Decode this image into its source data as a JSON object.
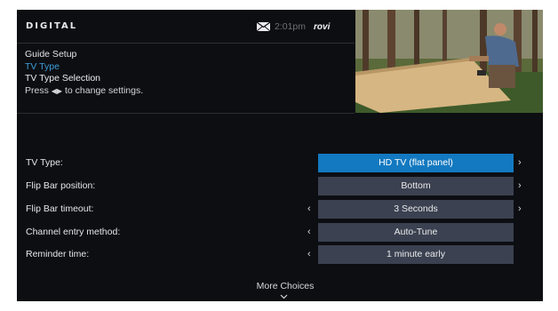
{
  "header": {
    "logo": "DIGITAL",
    "time": "2:01pm",
    "brand": "rovi",
    "mail_icon": "envelope-icon"
  },
  "breadcrumb": {
    "title": "Guide Setup",
    "subtitle": "TV Type",
    "current": "TV Type Selection",
    "instruction_prefix": "Press",
    "instruction_arrows": "◀▶",
    "instruction_suffix": "to change settings."
  },
  "settings": [
    {
      "label": "TV Type:",
      "value": "HD TV (flat panel)",
      "selected": true,
      "left_arrow": false,
      "right_arrow": true
    },
    {
      "label": "Flip Bar position:",
      "value": "Bottom",
      "selected": false,
      "left_arrow": false,
      "right_arrow": true
    },
    {
      "label": "Flip Bar timeout:",
      "value": "3 Seconds",
      "selected": false,
      "left_arrow": true,
      "right_arrow": true
    },
    {
      "label": "Channel entry method:",
      "value": "Auto-Tune",
      "selected": false,
      "left_arrow": true,
      "right_arrow": false
    },
    {
      "label": "Reminder time:",
      "value": "1 minute early",
      "selected": false,
      "left_arrow": true,
      "right_arrow": false
    }
  ],
  "footer": {
    "more_label": "More Choices",
    "more_icon": "chevron-down-icon"
  },
  "colors": {
    "background": "#0d0e12",
    "accent": "#1379c0",
    "subtitle": "#3f9dd8",
    "row": "#3b4150"
  }
}
